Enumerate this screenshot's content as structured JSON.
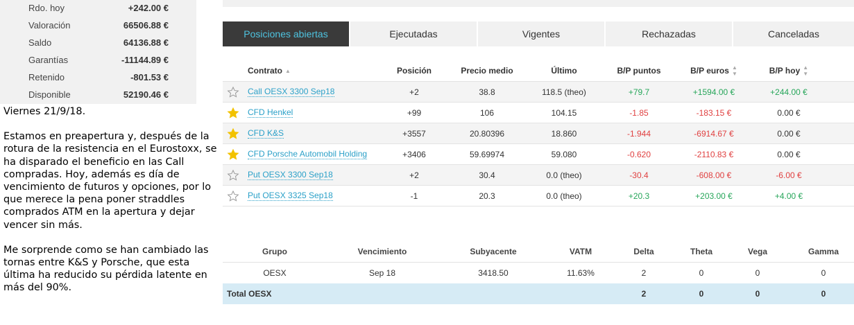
{
  "summary": [
    {
      "label": "Rdo. hoy",
      "value": "+242.00 €"
    },
    {
      "label": "Valoración",
      "value": "66506.88 €"
    },
    {
      "label": "Saldo",
      "value": "64136.88 €"
    },
    {
      "label": "Garantías",
      "value": "-11144.89 €"
    },
    {
      "label": "Retenido",
      "value": "-801.53 €"
    },
    {
      "label": "Disponible",
      "value": "52190.46 €"
    }
  ],
  "post": {
    "date": "Viernes 21/9/18.",
    "p1": "Estamos en preapertura y, después de la rotura de la resistencia en el Eurostoxx, se ha disparado el beneficio en las Call compradas. Hoy, además es día de vencimiento de futuros y opciones, por lo que merece la pena poner straddles comprados ATM en la apertura y dejar vencer sin más.",
    "p2": "Me sorprende como se han cambiado las tornas entre K&S y Porsche, que esta última ha reducido su pérdida latente en más del 90%."
  },
  "tabs": [
    "Posiciones abiertas",
    "Ejecutadas",
    "Vigentes",
    "Rechazadas",
    "Canceladas"
  ],
  "positions": {
    "headers": {
      "contrato": "Contrato",
      "posicion": "Posición",
      "precio": "Precio medio",
      "ultimo": "Último",
      "bp_puntos": "B/P puntos",
      "bp_euros": "B/P euros",
      "bp_hoy": "B/P hoy"
    },
    "rows": [
      {
        "name": "Call OESX 3300 Sep18",
        "fav": false,
        "pos": "+2",
        "precio": "38.8",
        "ultimo": "118.5 (theo)",
        "bpp": "+79.7",
        "bpe": "+1594.00 €",
        "bph": "+244.00 €"
      },
      {
        "name": "CFD Henkel",
        "fav": true,
        "pos": "+99",
        "precio": "106",
        "ultimo": "104.15",
        "bpp": "-1.85",
        "bpe": "-183.15 €",
        "bph": "0.00 €"
      },
      {
        "name": "CFD K&S",
        "fav": true,
        "pos": "+3557",
        "precio": "20.80396",
        "ultimo": "18.860",
        "bpp": "-1.944",
        "bpe": "-6914.67 €",
        "bph": "0.00 €"
      },
      {
        "name": "CFD Porsche Automobil Holding",
        "fav": true,
        "pos": "+3406",
        "precio": "59.69974",
        "ultimo": "59.080",
        "bpp": "-0.620",
        "bpe": "-2110.83 €",
        "bph": "0.00 €"
      },
      {
        "name": "Put OESX 3300 Sep18",
        "fav": false,
        "pos": "+2",
        "precio": "30.4",
        "ultimo": "0.0 (theo)",
        "bpp": "-30.4",
        "bpe": "-608.00 €",
        "bph": "-6.00 €"
      },
      {
        "name": "Put OESX 3325 Sep18",
        "fav": false,
        "pos": "-1",
        "precio": "20.3",
        "ultimo": "0.0 (theo)",
        "bpp": "+20.3",
        "bpe": "+203.00 €",
        "bph": "+4.00 €"
      }
    ]
  },
  "greeks": {
    "headers": [
      "Grupo",
      "Vencimiento",
      "Subyacente",
      "VATM",
      "Delta",
      "Theta",
      "Vega",
      "Gamma"
    ],
    "row": [
      "OESX",
      "Sep 18",
      "3418.50",
      "11.63%",
      "2",
      "0",
      "0",
      "0"
    ],
    "total": {
      "label": "Total OESX",
      "delta": "2",
      "theta": "0",
      "vega": "0",
      "gamma": "0"
    }
  },
  "colors": {
    "positive": "#27a65a",
    "negative": "#e04040",
    "link": "#2aa0c8",
    "star": "#f2c200",
    "tab_active_bg": "#3a3a3a",
    "tab_active_text": "#4ec3e0"
  }
}
